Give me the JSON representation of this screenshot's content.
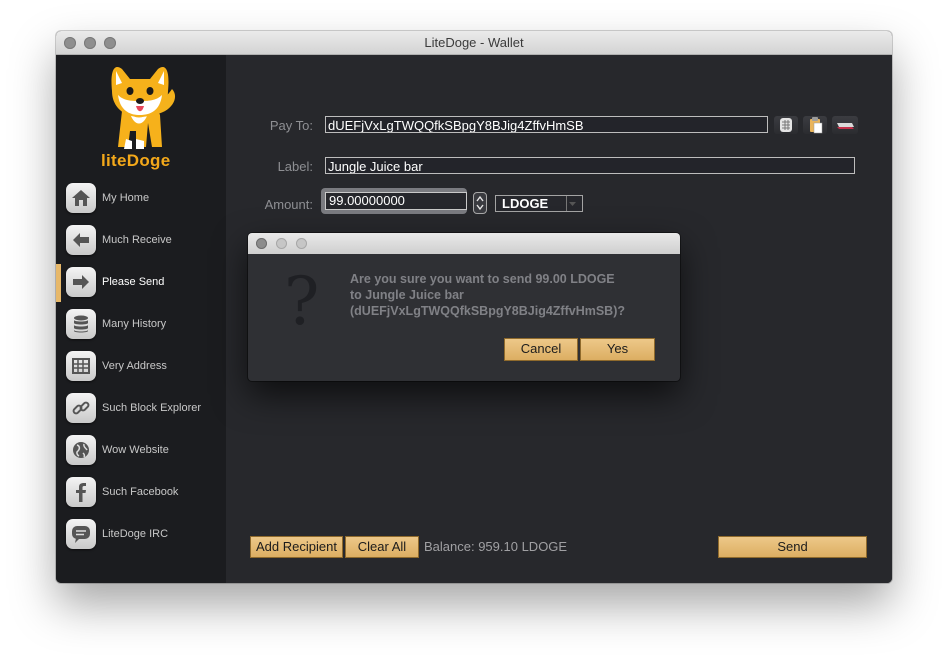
{
  "window": {
    "title": "LiteDoge - Wallet"
  },
  "brand": {
    "name": "liteDoge"
  },
  "nav": {
    "items": [
      {
        "label": "My Home",
        "icon": "home-icon"
      },
      {
        "label": "Much Receive",
        "icon": "arrow-left-icon"
      },
      {
        "label": "Please Send",
        "icon": "arrow-right-icon",
        "active": true
      },
      {
        "label": "Many History",
        "icon": "database-icon"
      },
      {
        "label": "Very Address",
        "icon": "address-book-icon"
      },
      {
        "label": "Such Block Explorer",
        "icon": "link-icon"
      },
      {
        "label": "Wow Website",
        "icon": "globe-icon"
      },
      {
        "label": "Such Facebook",
        "icon": "facebook-icon"
      },
      {
        "label": "LiteDoge IRC",
        "icon": "chat-icon"
      }
    ],
    "more_icon": "double-chevron-down-icon"
  },
  "send_form": {
    "pay_to_label": "Pay To:",
    "pay_to_value": "dUEFjVxLgTWQQfkSBpgY8BJig4ZffvHmSB",
    "label_label": "Label:",
    "label_value": "Jungle Juice bar",
    "amount_label": "Amount:",
    "amount_value": "99.00000000",
    "unit": "LDOGE",
    "tool_icons": [
      "address-book-icon",
      "paste-icon",
      "clear-icon"
    ]
  },
  "footer": {
    "add_recipient": "Add Recipient",
    "clear_all": "Clear All",
    "balance": "Balance: 959.10 LDOGE",
    "send": "Send"
  },
  "dialog": {
    "icon": "question-icon",
    "icon_glyph": "?",
    "message_line1": "Are you sure you want to send 99.00 LDOGE",
    "message_line2": "to Jungle Juice bar",
    "message_line3": "(dUEFjVxLgTWQQfkSBpgY8BJig4ZffvHmSB)?",
    "cancel": "Cancel",
    "yes": "Yes"
  },
  "colors": {
    "accent": "#e7b86a",
    "sidebar_bg": "#1b1c1f",
    "main_bg": "#27282c",
    "brand_orange": "#f3a81a"
  }
}
